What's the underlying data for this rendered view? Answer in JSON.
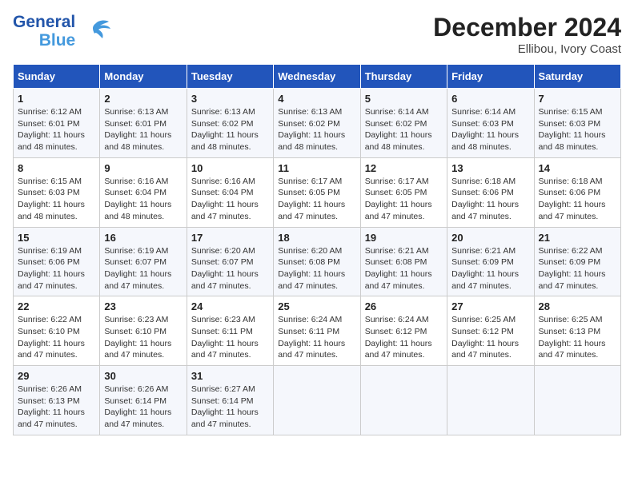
{
  "header": {
    "logo_line1": "General",
    "logo_line2": "Blue",
    "title": "December 2024",
    "subtitle": "Ellibou, Ivory Coast"
  },
  "columns": [
    "Sunday",
    "Monday",
    "Tuesday",
    "Wednesday",
    "Thursday",
    "Friday",
    "Saturday"
  ],
  "weeks": [
    [
      {
        "day": "1",
        "lines": [
          "Sunrise: 6:12 AM",
          "Sunset: 6:01 PM",
          "Daylight: 11 hours",
          "and 48 minutes."
        ]
      },
      {
        "day": "2",
        "lines": [
          "Sunrise: 6:13 AM",
          "Sunset: 6:01 PM",
          "Daylight: 11 hours",
          "and 48 minutes."
        ]
      },
      {
        "day": "3",
        "lines": [
          "Sunrise: 6:13 AM",
          "Sunset: 6:02 PM",
          "Daylight: 11 hours",
          "and 48 minutes."
        ]
      },
      {
        "day": "4",
        "lines": [
          "Sunrise: 6:13 AM",
          "Sunset: 6:02 PM",
          "Daylight: 11 hours",
          "and 48 minutes."
        ]
      },
      {
        "day": "5",
        "lines": [
          "Sunrise: 6:14 AM",
          "Sunset: 6:02 PM",
          "Daylight: 11 hours",
          "and 48 minutes."
        ]
      },
      {
        "day": "6",
        "lines": [
          "Sunrise: 6:14 AM",
          "Sunset: 6:03 PM",
          "Daylight: 11 hours",
          "and 48 minutes."
        ]
      },
      {
        "day": "7",
        "lines": [
          "Sunrise: 6:15 AM",
          "Sunset: 6:03 PM",
          "Daylight: 11 hours",
          "and 48 minutes."
        ]
      }
    ],
    [
      {
        "day": "8",
        "lines": [
          "Sunrise: 6:15 AM",
          "Sunset: 6:03 PM",
          "Daylight: 11 hours",
          "and 48 minutes."
        ]
      },
      {
        "day": "9",
        "lines": [
          "Sunrise: 6:16 AM",
          "Sunset: 6:04 PM",
          "Daylight: 11 hours",
          "and 48 minutes."
        ]
      },
      {
        "day": "10",
        "lines": [
          "Sunrise: 6:16 AM",
          "Sunset: 6:04 PM",
          "Daylight: 11 hours",
          "and 47 minutes."
        ]
      },
      {
        "day": "11",
        "lines": [
          "Sunrise: 6:17 AM",
          "Sunset: 6:05 PM",
          "Daylight: 11 hours",
          "and 47 minutes."
        ]
      },
      {
        "day": "12",
        "lines": [
          "Sunrise: 6:17 AM",
          "Sunset: 6:05 PM",
          "Daylight: 11 hours",
          "and 47 minutes."
        ]
      },
      {
        "day": "13",
        "lines": [
          "Sunrise: 6:18 AM",
          "Sunset: 6:06 PM",
          "Daylight: 11 hours",
          "and 47 minutes."
        ]
      },
      {
        "day": "14",
        "lines": [
          "Sunrise: 6:18 AM",
          "Sunset: 6:06 PM",
          "Daylight: 11 hours",
          "and 47 minutes."
        ]
      }
    ],
    [
      {
        "day": "15",
        "lines": [
          "Sunrise: 6:19 AM",
          "Sunset: 6:06 PM",
          "Daylight: 11 hours",
          "and 47 minutes."
        ]
      },
      {
        "day": "16",
        "lines": [
          "Sunrise: 6:19 AM",
          "Sunset: 6:07 PM",
          "Daylight: 11 hours",
          "and 47 minutes."
        ]
      },
      {
        "day": "17",
        "lines": [
          "Sunrise: 6:20 AM",
          "Sunset: 6:07 PM",
          "Daylight: 11 hours",
          "and 47 minutes."
        ]
      },
      {
        "day": "18",
        "lines": [
          "Sunrise: 6:20 AM",
          "Sunset: 6:08 PM",
          "Daylight: 11 hours",
          "and 47 minutes."
        ]
      },
      {
        "day": "19",
        "lines": [
          "Sunrise: 6:21 AM",
          "Sunset: 6:08 PM",
          "Daylight: 11 hours",
          "and 47 minutes."
        ]
      },
      {
        "day": "20",
        "lines": [
          "Sunrise: 6:21 AM",
          "Sunset: 6:09 PM",
          "Daylight: 11 hours",
          "and 47 minutes."
        ]
      },
      {
        "day": "21",
        "lines": [
          "Sunrise: 6:22 AM",
          "Sunset: 6:09 PM",
          "Daylight: 11 hours",
          "and 47 minutes."
        ]
      }
    ],
    [
      {
        "day": "22",
        "lines": [
          "Sunrise: 6:22 AM",
          "Sunset: 6:10 PM",
          "Daylight: 11 hours",
          "and 47 minutes."
        ]
      },
      {
        "day": "23",
        "lines": [
          "Sunrise: 6:23 AM",
          "Sunset: 6:10 PM",
          "Daylight: 11 hours",
          "and 47 minutes."
        ]
      },
      {
        "day": "24",
        "lines": [
          "Sunrise: 6:23 AM",
          "Sunset: 6:11 PM",
          "Daylight: 11 hours",
          "and 47 minutes."
        ]
      },
      {
        "day": "25",
        "lines": [
          "Sunrise: 6:24 AM",
          "Sunset: 6:11 PM",
          "Daylight: 11 hours",
          "and 47 minutes."
        ]
      },
      {
        "day": "26",
        "lines": [
          "Sunrise: 6:24 AM",
          "Sunset: 6:12 PM",
          "Daylight: 11 hours",
          "and 47 minutes."
        ]
      },
      {
        "day": "27",
        "lines": [
          "Sunrise: 6:25 AM",
          "Sunset: 6:12 PM",
          "Daylight: 11 hours",
          "and 47 minutes."
        ]
      },
      {
        "day": "28",
        "lines": [
          "Sunrise: 6:25 AM",
          "Sunset: 6:13 PM",
          "Daylight: 11 hours",
          "and 47 minutes."
        ]
      }
    ],
    [
      {
        "day": "29",
        "lines": [
          "Sunrise: 6:26 AM",
          "Sunset: 6:13 PM",
          "Daylight: 11 hours",
          "and 47 minutes."
        ]
      },
      {
        "day": "30",
        "lines": [
          "Sunrise: 6:26 AM",
          "Sunset: 6:14 PM",
          "Daylight: 11 hours",
          "and 47 minutes."
        ]
      },
      {
        "day": "31",
        "lines": [
          "Sunrise: 6:27 AM",
          "Sunset: 6:14 PM",
          "Daylight: 11 hours",
          "and 47 minutes."
        ]
      },
      null,
      null,
      null,
      null
    ]
  ]
}
